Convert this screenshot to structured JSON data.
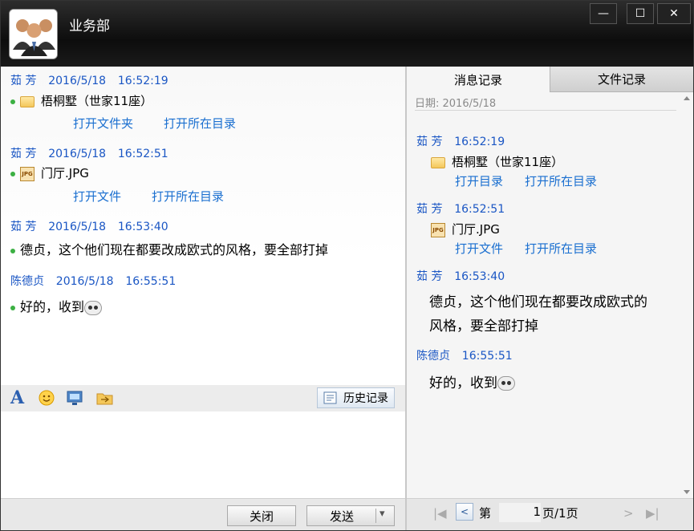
{
  "window": {
    "title": "业务部",
    "buttons": {
      "minimize": "—",
      "maximize": "☐",
      "close": "✕"
    }
  },
  "chat": {
    "messages": [
      {
        "sender": "茹 芳",
        "date": "2016/5/18",
        "time": "16:52:19",
        "file_name": "梧桐墅（世家11座）",
        "file_icon": "folder-icon",
        "actions": [
          "打开文件夹",
          "打开所在目录"
        ]
      },
      {
        "sender": "茹 芳",
        "date": "2016/5/18",
        "time": "16:52:51",
        "file_name": "门厅.JPG",
        "file_icon": "jpg-file-icon",
        "actions": [
          "打开文件",
          "打开所在目录"
        ]
      },
      {
        "sender": "茹 芳",
        "date": "2016/5/18",
        "time": "16:53:40",
        "text": "德贞，这个他们现在都要改成欧式的风格，要全部打掉"
      },
      {
        "sender": "陈德贞",
        "date": "2016/5/18",
        "time": "16:55:51",
        "text": "好的，收到"
      }
    ],
    "toolbar": {
      "font_icon": "A",
      "history_label": "历史记录"
    },
    "buttons": {
      "close": "关闭",
      "send": "发送",
      "send_dropdown": "▾"
    }
  },
  "history": {
    "tabs": [
      "消息记录",
      "文件记录"
    ],
    "active_tab": "消息记录",
    "date_label": "日期: 2016/5/18",
    "entries": [
      {
        "sender": "茹 芳",
        "time": "16:52:19",
        "file_name": "梧桐墅（世家11座）",
        "actions": [
          "打开目录",
          "打开所在目录"
        ]
      },
      {
        "sender": "茹 芳",
        "time": "16:52:51",
        "file_name": "门厅.JPG",
        "actions": [
          "打开文件",
          "打开所在目录"
        ]
      },
      {
        "sender": "茹 芳",
        "time": "16:53:40",
        "text_line1": "德贞，这个他们现在都要改成欧式的",
        "text_line2": "风格，要全部打掉"
      },
      {
        "sender": "陈德贞",
        "time": "16:55:51",
        "text": "好的，收到"
      }
    ],
    "pager": {
      "prefix": "第",
      "page": "1",
      "suffix": "页/1页"
    }
  },
  "colors": {
    "link": "#1a6fd0",
    "sender": "#1a56c4",
    "online_dot": "#3cb043"
  }
}
